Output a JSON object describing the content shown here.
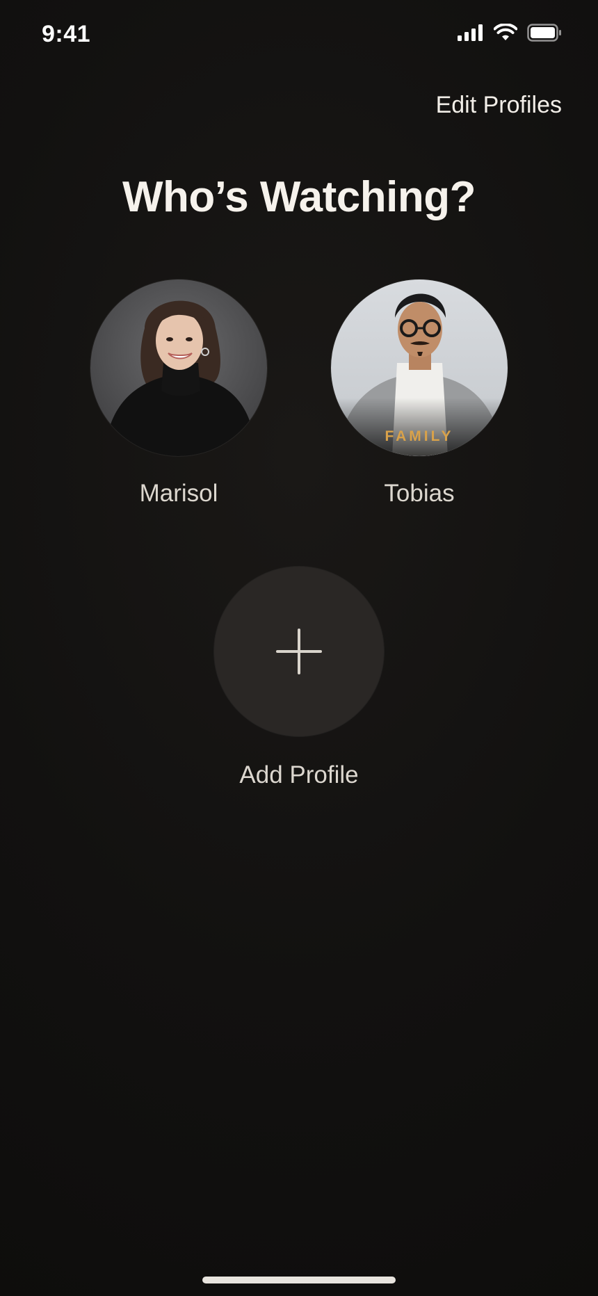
{
  "status_bar": {
    "time": "9:41",
    "signal_icon": "cellular-signal-icon",
    "wifi_icon": "wifi-icon",
    "battery_icon": "battery-icon"
  },
  "header": {
    "edit_label": "Edit Profiles"
  },
  "title": "Who’s Watching?",
  "profiles": [
    {
      "name": "Marisol",
      "avatar": "woman-portrait-avatar",
      "badge": ""
    },
    {
      "name": "Tobias",
      "avatar": "man-portrait-avatar",
      "badge": "FAMILY"
    }
  ],
  "add_profile": {
    "label": "Add Profile",
    "icon": "plus-icon"
  },
  "colors": {
    "background": "#121110",
    "text": "#f2eee8",
    "badge": "#d9a24a",
    "add_circle": "#2a2725"
  }
}
